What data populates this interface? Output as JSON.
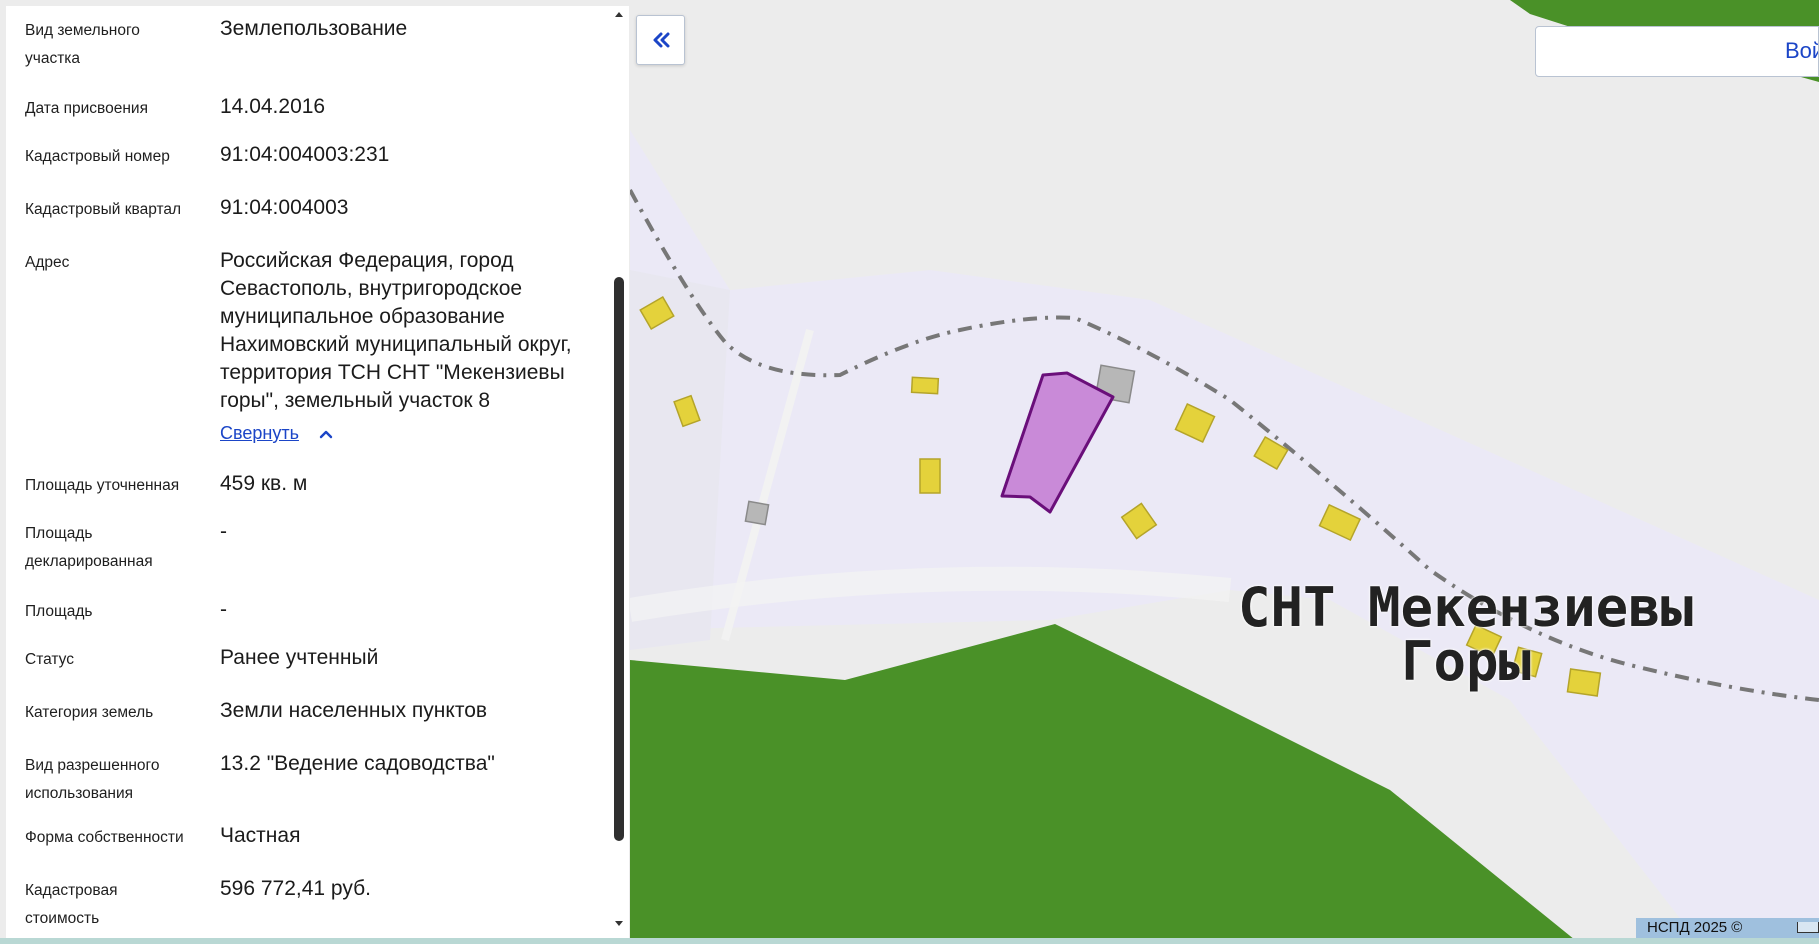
{
  "fields": [
    {
      "label": "Вид земельного участка",
      "value": "Землепользование"
    },
    {
      "label": "Дата присвоения",
      "value": "14.04.2016"
    },
    {
      "label": "Кадастровый номер",
      "value": "91:04:004003:231"
    },
    {
      "label": "Кадастровый квартал",
      "value": "91:04:004003"
    },
    {
      "label": "Адрес",
      "value": "Российская Федерация, город Севастополь, внутригородское муниципальное образование Нахимовский муниципальный округ, территория ТСН СНТ \"Мекензиевы горы\", земельный участок 8"
    },
    {
      "label": "Площадь уточненная",
      "value": "459 кв. м"
    },
    {
      "label": "Площадь декларированная",
      "value": "-"
    },
    {
      "label": "Площадь",
      "value": "-"
    },
    {
      "label": "Статус",
      "value": "Ранее учтенный"
    },
    {
      "label": "Категория земель",
      "value": "Земли населенных пунктов"
    },
    {
      "label": "Вид разрешенного использования",
      "value": "13.2 \"Ведение садоводства\""
    },
    {
      "label": "Форма собственности",
      "value": "Частная"
    },
    {
      "label": "Кадастровая стоимость",
      "value": "596 772,41 руб."
    }
  ],
  "address_collapse_label": "Свернуть",
  "map": {
    "place_label_line1": "СНТ Мекензиевы",
    "place_label_line2": "Горы",
    "login_label": "Вой",
    "attribution": "НСПД 2025 ©"
  },
  "icons": {
    "expand": "double-chevron-left-icon",
    "collapse": "chevron-up-icon",
    "scroll_up": "triangle-up-icon",
    "scroll_down": "triangle-down-icon"
  },
  "colors": {
    "link": "#1b45c7",
    "selected_parcel_fill": "#c98ad8",
    "selected_parcel_stroke": "#6a0f7a",
    "forest": "#4a9128",
    "buildings": "#e4d23b"
  }
}
